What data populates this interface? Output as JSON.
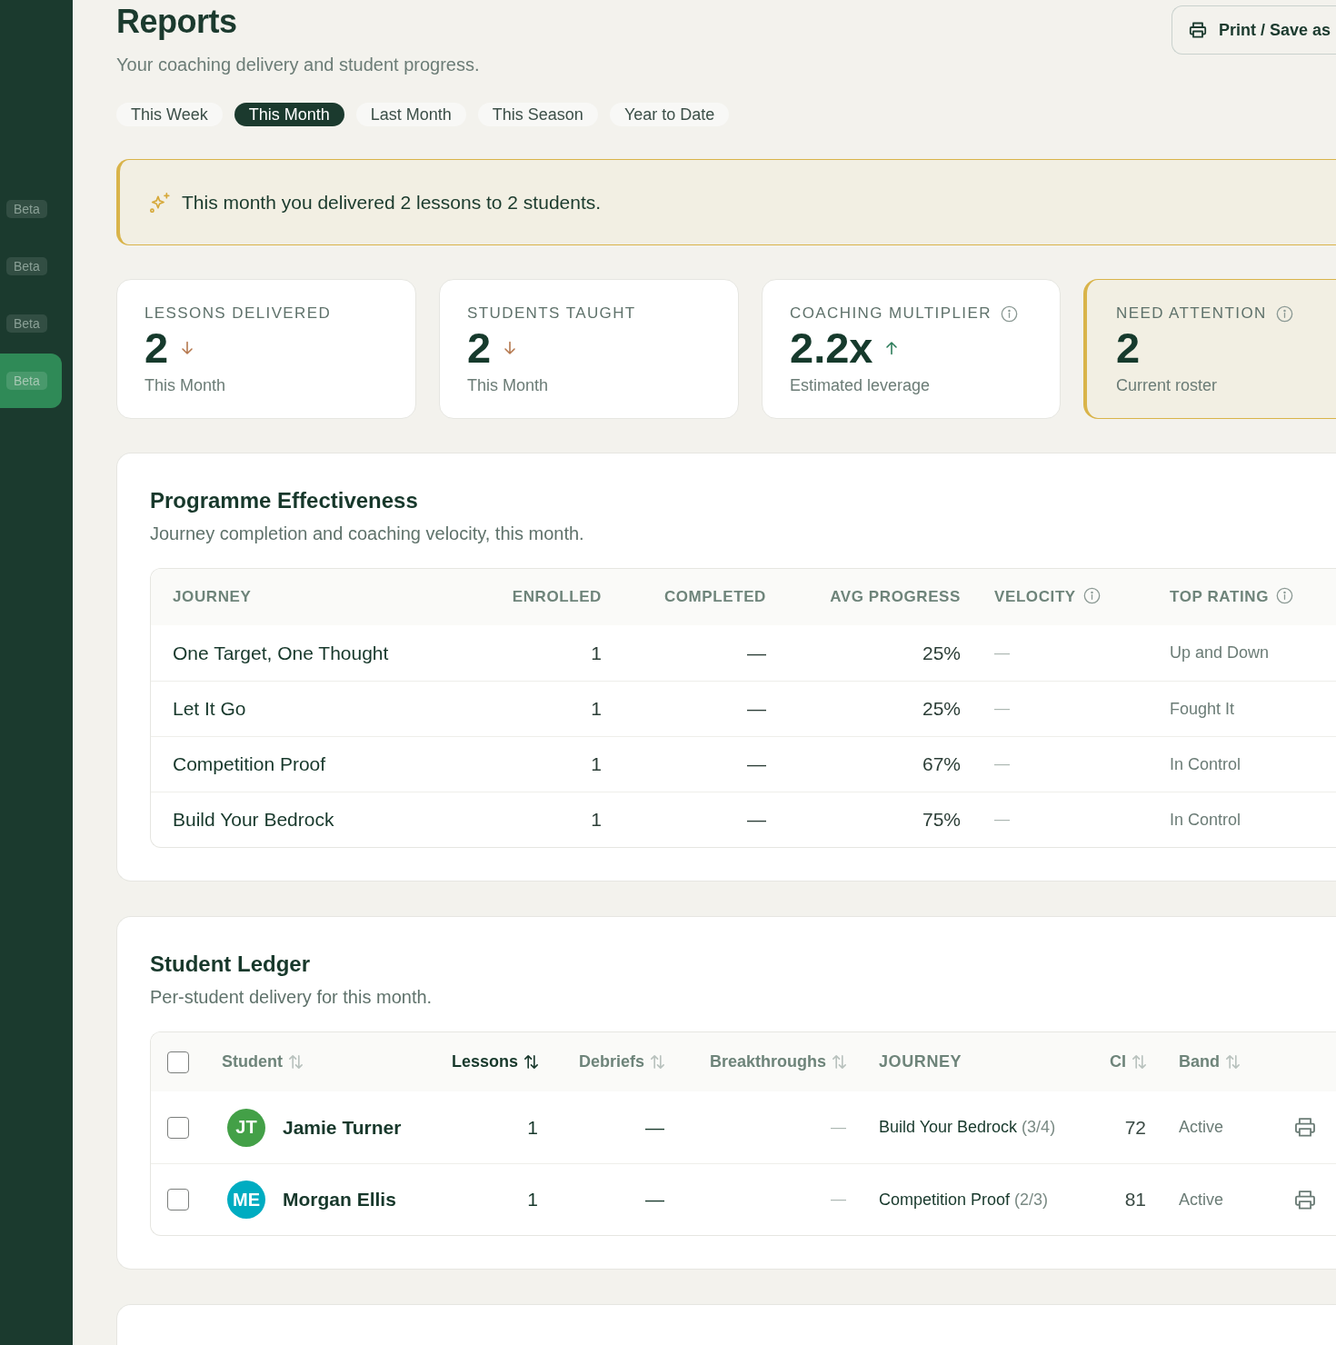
{
  "sidebar": {
    "items": [
      {
        "badge": "Beta",
        "selected": false
      },
      {
        "badge": "Beta",
        "selected": false
      },
      {
        "badge": "Beta",
        "selected": false
      },
      {
        "badge": "Beta",
        "selected": true
      }
    ]
  },
  "header": {
    "title": "Reports",
    "subtitle": "Your coaching delivery and student progress.",
    "action": "Print / Save as"
  },
  "periods": [
    {
      "label": "This Week",
      "selected": false
    },
    {
      "label": "This Month",
      "selected": true
    },
    {
      "label": "Last Month",
      "selected": false
    },
    {
      "label": "This Season",
      "selected": false
    },
    {
      "label": "Year to Date",
      "selected": false
    }
  ],
  "banner": {
    "text": "This month you delivered 2 lessons to 2 students."
  },
  "stats": [
    {
      "kind": "falling",
      "label": "LESSONS DELIVERED",
      "value": "2",
      "caption": "This Month",
      "info": false
    },
    {
      "kind": "falling",
      "label": "STUDENTS TAUGHT",
      "value": "2",
      "caption": "This Month",
      "info": false
    },
    {
      "kind": "rising",
      "label": "COACHING MULTIPLIER",
      "value": "2.2x",
      "caption": "Estimated leverage",
      "info": true
    },
    {
      "kind": "alert",
      "label": "NEED ATTENTION",
      "value": "2",
      "caption": "Current roster",
      "info": true
    }
  ],
  "programme": {
    "title": "Programme Effectiveness",
    "subtitle": "Journey completion and coaching velocity, this month.",
    "columns": [
      {
        "label": "JOURNEY",
        "info": false
      },
      {
        "label": "ENROLLED",
        "info": false
      },
      {
        "label": "COMPLETED",
        "info": false
      },
      {
        "label": "AVG PROGRESS",
        "info": false
      },
      {
        "label": "VELOCITY",
        "info": true
      },
      {
        "label": "TOP RATING",
        "info": true
      }
    ],
    "rows": [
      {
        "journey": "One Target, One Thought",
        "enrolled": "1",
        "completed": "—",
        "avg_progress": "25%",
        "velocity": "—",
        "top_rating": "Up and Down"
      },
      {
        "journey": "Let It Go",
        "enrolled": "1",
        "completed": "—",
        "avg_progress": "25%",
        "velocity": "—",
        "top_rating": "Fought It"
      },
      {
        "journey": "Competition Proof",
        "enrolled": "1",
        "completed": "—",
        "avg_progress": "67%",
        "velocity": "—",
        "top_rating": "In Control"
      },
      {
        "journey": "Build Your Bedrock",
        "enrolled": "1",
        "completed": "—",
        "avg_progress": "75%",
        "velocity": "—",
        "top_rating": "In Control"
      }
    ]
  },
  "ledger": {
    "title": "Student Ledger",
    "subtitle": "Per-student delivery for this month.",
    "select_all": {
      "checked": false
    },
    "columns": [
      {
        "label": "Student",
        "sortable": true,
        "selected": false
      },
      {
        "label": "Lessons",
        "sortable": true,
        "selected": true
      },
      {
        "label": "Debriefs",
        "sortable": true,
        "selected": false
      },
      {
        "label": "Breakthroughs",
        "sortable": true,
        "selected": false
      },
      {
        "label": "JOURNEY",
        "sortable": false,
        "selected": false
      },
      {
        "label": "CI",
        "sortable": true,
        "selected": false
      },
      {
        "label": "Band",
        "sortable": true,
        "selected": false
      }
    ],
    "rows": [
      {
        "checked": false,
        "initials": "JT",
        "color": "#43a047",
        "name": "Jamie Turner",
        "lessons": "1",
        "debriefs": "—",
        "breakthroughs": "—",
        "journey": "Build Your Bedrock",
        "journey_progress": "(3/4)",
        "ci": "72",
        "band": "Active"
      },
      {
        "checked": false,
        "initials": "ME",
        "color": "#00acc1",
        "name": "Morgan Ellis",
        "lessons": "1",
        "debriefs": "—",
        "breakthroughs": "—",
        "journey": "Competition Proof",
        "journey_progress": "(2/3)",
        "ci": "81",
        "band": "Active"
      }
    ]
  }
}
